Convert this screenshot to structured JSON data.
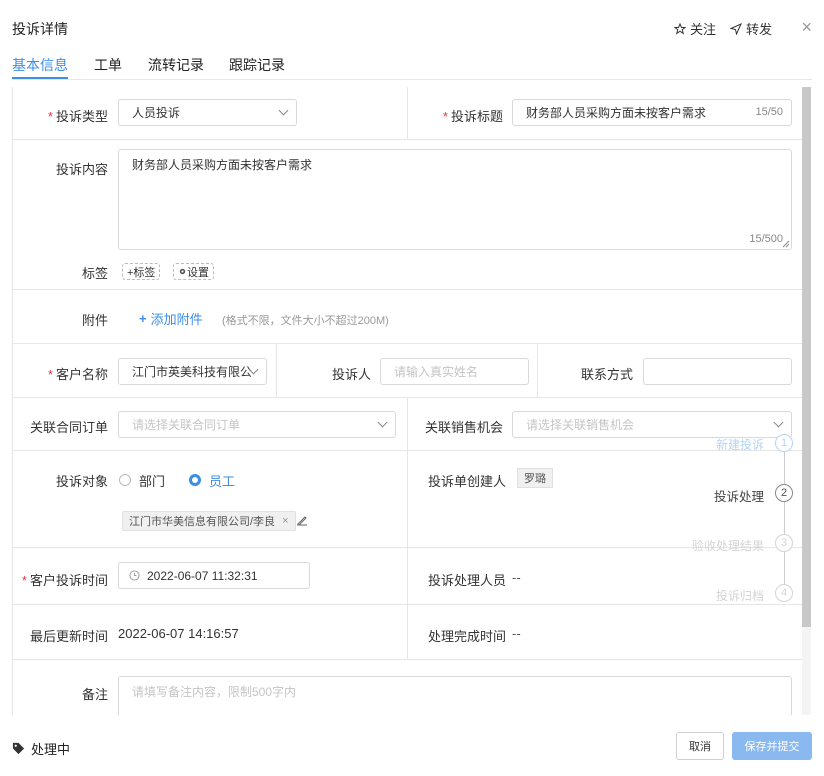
{
  "dialog": {
    "title": "投诉详情",
    "follow": "关注",
    "forward": "转发"
  },
  "tabs": [
    "基本信息",
    "工单",
    "流转记录",
    "跟踪记录"
  ],
  "form": {
    "type_label": "投诉类型",
    "type_value": "人员投诉",
    "subject_label": "投诉标题",
    "subject_value": "财务部人员采购方面未按客户需求",
    "subject_count": "15/50",
    "content_label": "投诉内容",
    "content_value": "财务部人员采购方面未按客户需求",
    "content_count": "15/500",
    "tags_label": "标签",
    "add_tag": "+标签",
    "tag_settings": "设置",
    "attach_label": "附件",
    "add_attach": "添加附件",
    "attach_hint": "(格式不限，文件大小不超过200M)",
    "customer_label": "客户名称",
    "customer_value": "江门市英美科技有限公",
    "complainant_label": "投诉人",
    "complainant_placeholder": "请输入真实姓名",
    "contact_label": "联系方式",
    "contact_value": "",
    "contract_label": "关联合同订单",
    "contract_placeholder": "请选择关联合同订单",
    "opportunity_label": "关联销售机会",
    "opportunity_placeholder": "请选择关联销售机会",
    "target_label": "投诉对象",
    "target_options": [
      "部门",
      "员工"
    ],
    "target_selected": "员工",
    "target_chip": "江门市华美信息有限公司/李良",
    "creator_label": "投诉单创建人",
    "creator_value": "罗璐",
    "time_label": "客户投诉时间",
    "time_value": "2022-06-07 11:32:31",
    "handler_label": "投诉处理人员",
    "handler_value": "--",
    "updated_label": "最后更新时间",
    "updated_value": "2022-06-07 14:16:57",
    "finished_label": "处理完成时间",
    "finished_value": "--",
    "remark_label": "备注",
    "remark_placeholder": "请填写备注内容，限制500字内"
  },
  "steps": [
    {
      "label": "新建投诉",
      "num": "1",
      "state": "done"
    },
    {
      "label": "投诉处理",
      "num": "2",
      "state": "current"
    },
    {
      "label": "验收处理结果",
      "num": "3",
      "state": "todo"
    },
    {
      "label": "投诉归档",
      "num": "4",
      "state": "todo"
    }
  ],
  "footer": {
    "status": "处理中",
    "cancel": "取消",
    "save": "保存并提交"
  },
  "colors": {
    "accent": "#3d8ee6",
    "required": "#e4393c",
    "save_button": "#8ab9f0"
  }
}
